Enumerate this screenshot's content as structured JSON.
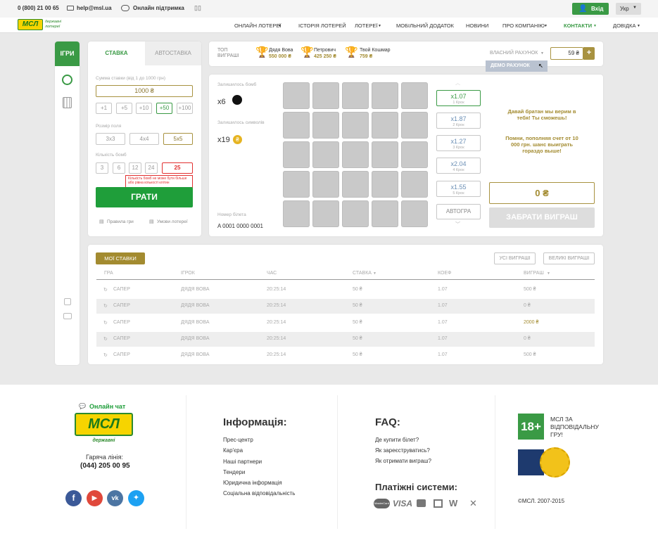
{
  "topbar": {
    "phone": "0 (800) 21 00 65",
    "email": "help@msl.ua",
    "support": "Онлайн підтримка",
    "login": "Вхід",
    "lang": "Укр"
  },
  "nav": {
    "logo_text": "МСЛ",
    "logo_sub1": "державні",
    "logo_sub2": "лотереї",
    "items": [
      "ОНЛАЙН ЛОТЕРЕЇ",
      "ІСТОРІЯ ЛОТЕРЕЙ",
      "ЛОТЕРЕЇ",
      "МОБІЛЬНИЙ ДОДАТОК",
      "НОВИНИ",
      "ПРО КОМПАНІЮ",
      "КОНТАКТИ",
      "ДОВІДКА"
    ]
  },
  "sidebar": {
    "games": "ІГРИ"
  },
  "bet": {
    "tab_bet": "СТАВКА",
    "tab_auto": "АВТОСТАВКА",
    "amount_label": "Сумма ставки (від 1 до 1000 грн)",
    "amount": "1000 ₴",
    "quick": [
      "+1",
      "+5",
      "+10",
      "+50",
      "+100"
    ],
    "field_label": "Розмір поля",
    "fields": [
      "3x3",
      "4x4",
      "5x5"
    ],
    "bombs_label": "Кількість бомб",
    "bombs": [
      "3",
      "6",
      "12",
      "24",
      "25"
    ],
    "error": "Кількість бомб не може бути більше або рівна кількості клітин",
    "play": "ГРАТИ",
    "rules": "Правила гри",
    "terms": "Умови лотереї"
  },
  "top": {
    "label1": "ТОП",
    "label2": "ВИГРАШІ",
    "winners": [
      {
        "name": "Дядя Вова",
        "amount": "550 000 ₴"
      },
      {
        "name": "Петрович",
        "amount": "425 250 ₴"
      },
      {
        "name": "Твой Кошмар",
        "amount": "759 ₴"
      }
    ],
    "account": "ВЛАСНИЙ РАХУНОК",
    "balance": "59 ₴",
    "plus": "+",
    "demo": "ДЕМО РАХУНОК"
  },
  "game": {
    "bombs_left": "Залишилось бомб",
    "bombs_count": "x6",
    "symbols_left": "Залишилось символів",
    "symbols_count": "x19",
    "ticket_label": "Номер білета",
    "ticket": "A 0001 0000 0001",
    "multipliers": [
      {
        "v": "x1.07",
        "s": "1 Крок"
      },
      {
        "v": "x1.87",
        "s": "2 Крок"
      },
      {
        "v": "x1.27",
        "s": "3 Крок"
      },
      {
        "v": "x2.04",
        "s": "4 Крок"
      },
      {
        "v": "x1.55",
        "s": "5 Крок"
      }
    ],
    "autoplay": "АВТОГРА",
    "msg1": "Давай братан мы верим в тебя! Ты сможешь!",
    "msg2": "Помни, пополняя счет от 10 000 грн. шанс выиграть гораздо выше!",
    "win": "0 ₴",
    "collect": "ЗАБРАТИ ВИГРАШ"
  },
  "history": {
    "my_bets": "МОЇ СТАВКИ",
    "all_wins": "УСІ ВИГРАШІ",
    "big_wins": "ВЕЛИКІ ВИГРАШІ",
    "headers": [
      "ГРА",
      "ІГРОК",
      "ЧАС",
      "СТАВКА",
      "КОЕФ",
      "ВИГРАШ"
    ],
    "rows": [
      [
        "САПЕР",
        "ДЯДЯ ВОВА",
        "20:25:14",
        "50 ₴",
        "1.07",
        "500 ₴"
      ],
      [
        "САПЕР",
        "ДЯДЯ ВОВА",
        "20:25:14",
        "50 ₴",
        "1.07",
        "0 ₴"
      ],
      [
        "САПЕР",
        "ДЯДЯ ВОВА",
        "20:25:14",
        "50 ₴",
        "1.07",
        "2000 ₴"
      ],
      [
        "САПЕР",
        "ДЯДЯ ВОВА",
        "20:25:14",
        "50 ₴",
        "1.07",
        "0 ₴"
      ],
      [
        "САПЕР",
        "ДЯДЯ ВОВА",
        "20:25:14",
        "50 ₴",
        "1.07",
        "500 ₴"
      ]
    ]
  },
  "footer": {
    "chat": "Онлайн чат",
    "hotline_label": "Гаряча лінія:",
    "hotline": "(044) 205 00 95",
    "info_title": "Інформація:",
    "info_links": [
      "Прес-центр",
      "Кар'єра",
      "Наші партнери",
      "Тендери",
      "Юридична інформація",
      "Соціальна відповідальність"
    ],
    "faq_title": "FAQ:",
    "faq_links": [
      "Де купити білет?",
      "Як зареєструватись?",
      "Як отримати виграш?"
    ],
    "pay_title": "Платіжні системи:",
    "pay": [
      "MasterCard",
      "VISA"
    ],
    "age": "18+",
    "resp": "МСЛ ЗА ВІДПОВІДАЛЬНУ ГРУ!",
    "copyright": "©МСЛ. 2007-2015"
  }
}
